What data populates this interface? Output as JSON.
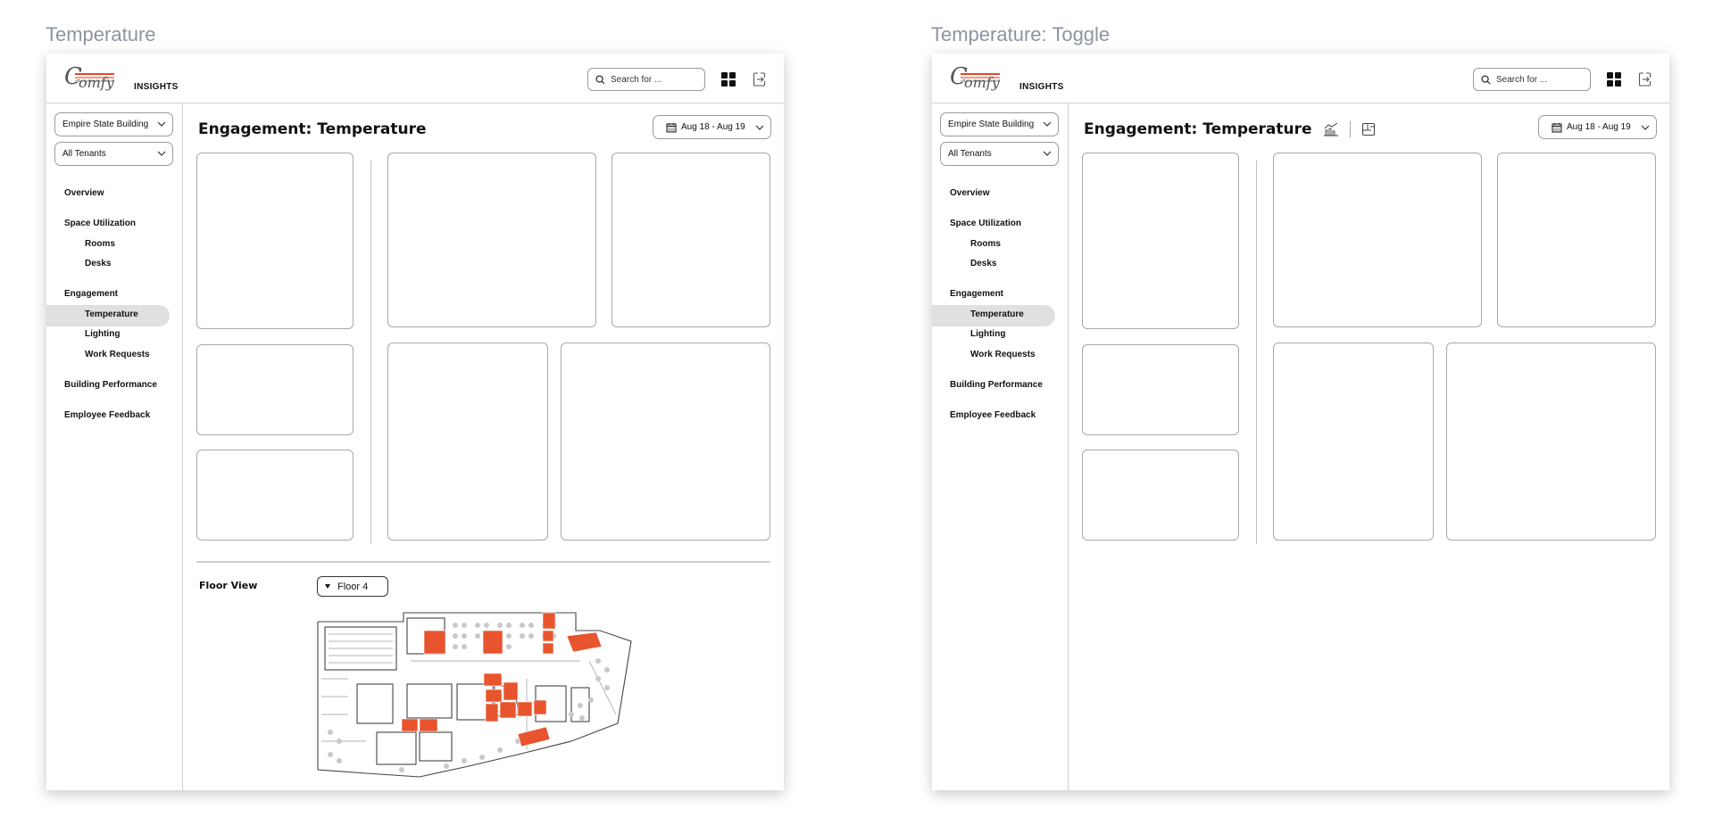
{
  "frames": [
    {
      "id": "temperature",
      "caption": "Temperature",
      "show_floor_view": true,
      "show_view_toggle": false
    },
    {
      "id": "temperature-toggle",
      "caption": "Temperature: Toggle",
      "show_floor_view": false,
      "show_view_toggle": true
    }
  ],
  "app": {
    "logo_text": "omfy",
    "logo_letter": "C",
    "logo_suffix": "INSIGHTS",
    "logo_stripe_colors": [
      "#e8452b",
      "#f29a84",
      "#b9c1cc"
    ]
  },
  "search": {
    "placeholder": "Search for ...",
    "icon": "search-icon"
  },
  "header_icons": [
    "apps-grid-icon",
    "logout-icon"
  ],
  "filters": {
    "building": "Empire State Building",
    "tenant": "All Tenants"
  },
  "nav": {
    "overview": "Overview",
    "space_utilization": "Space Utilization",
    "rooms": "Rooms",
    "desks": "Desks",
    "engagement": "Engagement",
    "temperature": "Temperature",
    "lighting": "Lighting",
    "work_requests": "Work Requests",
    "building_performance": "Building Performance",
    "employee_feedback": "Employee Feedback",
    "active": "Temperature"
  },
  "main": {
    "title": "Engagement: Temperature",
    "date_range": "Aug 18 - Aug 19",
    "toggle_icons": [
      "chart-view-icon",
      "floorplan-view-icon"
    ]
  },
  "floor_view": {
    "title": "Floor View",
    "floor_selected": "Floor 4",
    "highlight_color": "#e8542e"
  }
}
